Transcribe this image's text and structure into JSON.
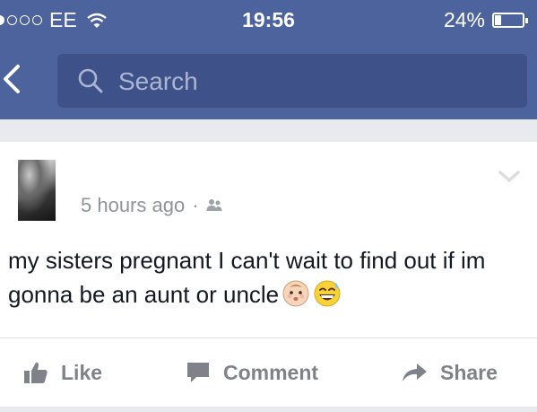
{
  "status_bar": {
    "carrier": "EE",
    "time": "19:56",
    "battery_percent": "24%",
    "battery_level": 0.24,
    "signal_dots_filled": 1,
    "signal_dots_total": 5
  },
  "nav": {
    "back_icon": "chevron-left-icon",
    "search_placeholder": "Search"
  },
  "post": {
    "timestamp": "5 hours ago",
    "separator": "·",
    "privacy_icon": "friends-icon",
    "text": "my sisters pregnant I can't wait to find out if im gonna be an aunt or uncle",
    "emojis": [
      "baby-face-emoji",
      "sweat-smile-emoji"
    ]
  },
  "actions": {
    "like_label": "Like",
    "comment_label": "Comment",
    "share_label": "Share"
  },
  "colors": {
    "header": "#4d639e",
    "search_box": "#3e5289",
    "action_text": "#7f8389",
    "meta_text": "#8f949a"
  }
}
